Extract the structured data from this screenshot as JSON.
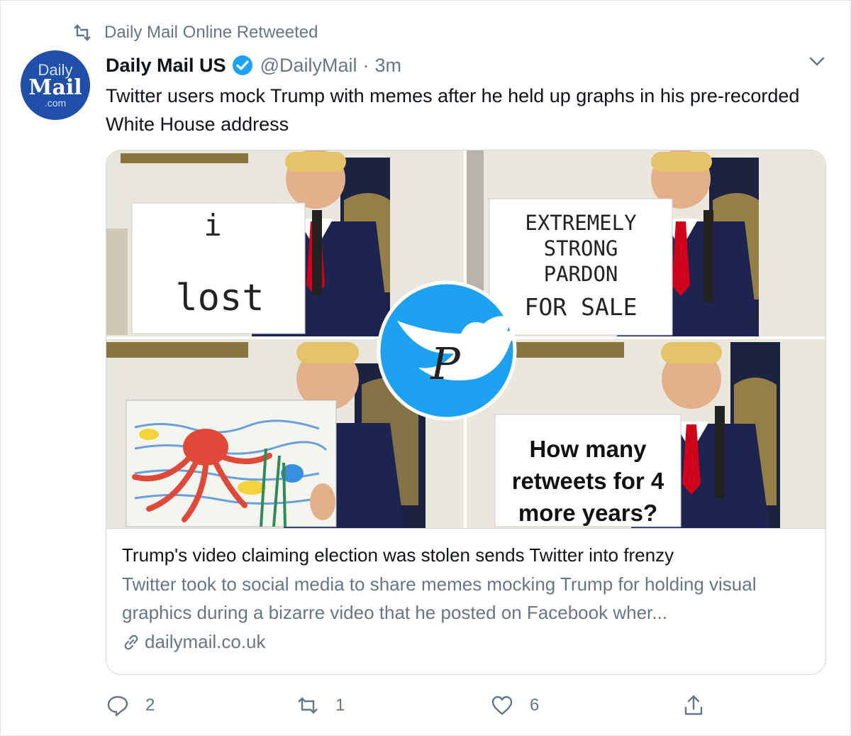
{
  "retweet_context": "Daily Mail Online Retweeted",
  "avatar": {
    "line1": "Daily",
    "line2": "Mail",
    "line3": ".com"
  },
  "tweet": {
    "display_name": "Daily Mail US",
    "handle": "@DailyMail",
    "separator": "·",
    "time": "3m",
    "text": "Twitter users mock Trump with memes after he held up graphs in his pre-recorded White House address"
  },
  "media": {
    "panels": [
      {
        "sign_text": [
          "i",
          "lost"
        ]
      },
      {
        "sign_text": [
          "EXTREMELY",
          "STRONG",
          "PARDON",
          "FOR SALE"
        ]
      },
      {
        "sign_text": []
      },
      {
        "sign_text": [
          "How many",
          "retweets for 4",
          "more years?"
        ]
      }
    ],
    "overlay_logo_letter": "P"
  },
  "card": {
    "title": "Trump's video claiming election was stolen sends Twitter into frenzy",
    "description": "Twitter took to social media to share memes mocking Trump for holding visual graphics during a bizarre video that he posted on Facebook wher...",
    "domain": "dailymail.co.uk"
  },
  "actions": {
    "reply_count": "2",
    "retweet_count": "1",
    "like_count": "6"
  },
  "colors": {
    "accent": "#1da1f2",
    "secondary_text": "#657786",
    "avatar_bg": "#1f4fa8",
    "tie_red": "#d0021b",
    "suit_navy": "#1d2450"
  }
}
